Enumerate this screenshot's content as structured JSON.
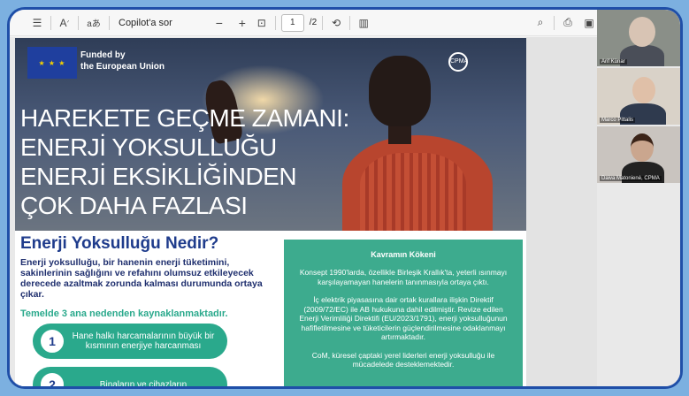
{
  "toolbar": {
    "aa_label": "A",
    "read_label": "aあ",
    "copilot_label": "Copilot'a sor",
    "zoom_out": "−",
    "zoom_in": "+",
    "page_current": "1",
    "page_total": "/2"
  },
  "banner": {
    "funded_line1": "Funded by",
    "funded_line2": "the European Union",
    "cpma_mark": "CPMA"
  },
  "headline": {
    "line1": "HAREKETE GEÇME ZAMANI:",
    "line2": "ENERJİ YOKSULLUĞU",
    "line3": "ENERJİ EKSİKLİĞİNDEN",
    "line4": "ÇOK DAHA FAZLASI"
  },
  "question": {
    "title": "Enerji Yoksulluğu Nedir?",
    "body": "Enerji yoksulluğu, bir hanenin enerji tüketimini, sakinlerinin sağlığını ve refahını olumsuz etkileyecek derecede azaltmak zorunda kalması durumunda ortaya çıkar.",
    "subtitle": "Temelde 3 ana nedenden kaynaklanmaktadır."
  },
  "causes": [
    {
      "num": "1",
      "text": "Hane halkı harcamalarının büyük bir kısmının enerjiye harcanması"
    },
    {
      "num": "2",
      "text": "Binaların ve cihazların"
    }
  ],
  "origin": {
    "title": "Kavramın Kökeni",
    "p1": "Konsept 1990'larda, özellikle Birleşik Krallık'ta, yeterli ısınmayı karşılayamayan hanelerin tanınmasıyla ortaya çıktı.",
    "p2": "İç elektrik piyasasına dair ortak kurallara ilişkin Direktif (2009/72/EC) ile AB hukukuna dahil edilmiştir. Revize edilen Enerji Verimliliği Direktifi (EU/2023/1791), enerji yoksulluğunun hafifletilmesine ve tüketicilerin güçlendirilmesine odaklanmayı artırmaktadır.",
    "p3": "CoM, küresel çaptaki yerel liderleri enerji yoksulluğu ile mücadelede desteklemektedir."
  },
  "participants": [
    {
      "name": "Arif Künar"
    },
    {
      "name": "Marco Pittalis"
    },
    {
      "name": "Daiva Matonienė, CPMA"
    }
  ]
}
